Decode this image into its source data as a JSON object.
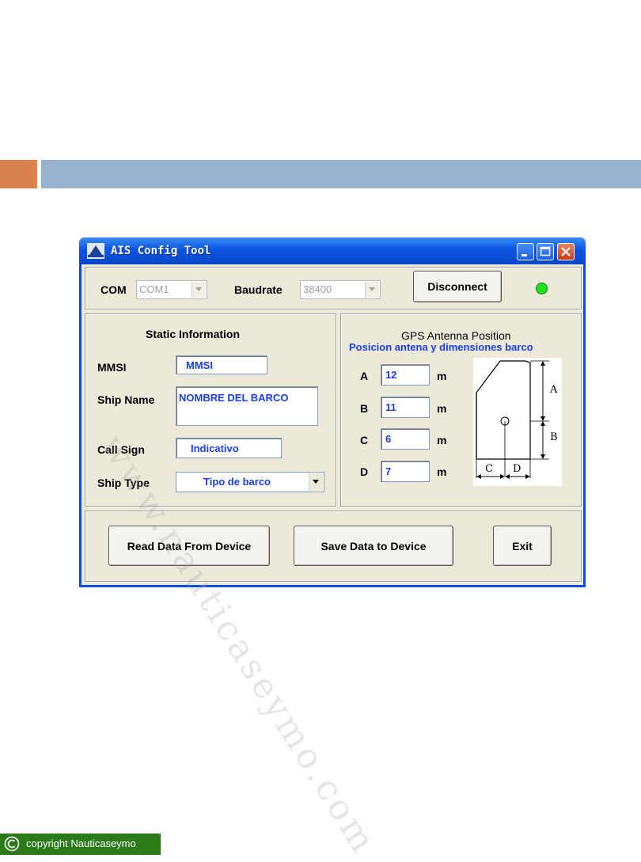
{
  "window": {
    "title": "AIS Config Tool"
  },
  "connection": {
    "com_label": "COM",
    "com_value": "COM1",
    "baud_label": "Baudrate",
    "baud_value": "38400",
    "disconnect_label": "Disconnect",
    "status_color": "#19e619"
  },
  "static_info": {
    "heading": "Static Information",
    "mmsi_label": "MMSI",
    "mmsi_value": "MMSI",
    "ship_name_label": "Ship Name",
    "ship_name_value": "NOMBRE DEL BARCO",
    "call_sign_label": "Call Sign",
    "call_sign_value": "Indicativo",
    "ship_type_label": "Ship Type",
    "ship_type_value": "Tipo de barco"
  },
  "gps": {
    "heading": "GPS Antenna Position",
    "subheading": "Posicion antena y dimensiones barco",
    "fields": [
      {
        "label": "A",
        "value": "12",
        "unit": "m"
      },
      {
        "label": "B",
        "value": "11",
        "unit": "m"
      },
      {
        "label": "C",
        "value": "6",
        "unit": "m"
      },
      {
        "label": "D",
        "value": "7",
        "unit": "m"
      }
    ],
    "diagram_labels": {
      "a": "A",
      "b": "B",
      "c": "C",
      "d": "D"
    }
  },
  "actions": {
    "read_label": "Read Data From Device",
    "save_label": "Save Data to Device",
    "exit_label": "Exit"
  },
  "watermark": "www.nauticaseymo.com",
  "copyright": "copyright  Nauticaseymo",
  "colors": {
    "accent_orange": "#d9824f",
    "accent_blue": "#97b3cf",
    "xp_blue": "#0a4fd8",
    "value_blue": "#1a3fe0"
  }
}
